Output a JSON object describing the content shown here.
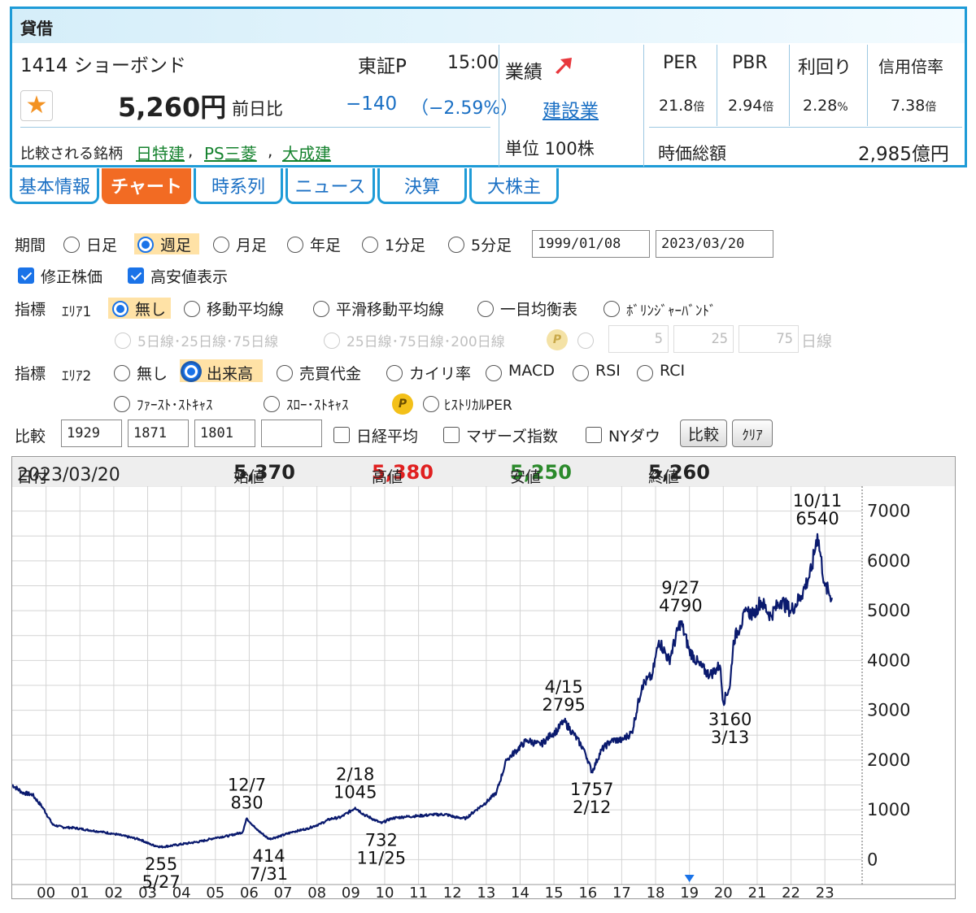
{
  "header": {
    "badge": "貸借",
    "code_name": "1414 ショーボンド",
    "market": "東証P",
    "time": "15:00",
    "price": "5,260円",
    "change_label": "前日比",
    "change": "−140",
    "change_pct": "（−2.59%）",
    "compare_label": "比較される銘柄",
    "compare_links": [
      "日特建",
      "PS三菱",
      "大成建"
    ],
    "sep": ",",
    "performance_label": "業績",
    "industry": "建設業",
    "unit": "単位 100株",
    "metrics": [
      {
        "name": "PER",
        "value": "21.8",
        "unit": "倍"
      },
      {
        "name": "PBR",
        "value": "2.94",
        "unit": "倍"
      },
      {
        "name": "利回り",
        "value": "2.28",
        "unit": "%"
      },
      {
        "name": "信用倍率",
        "value": "7.38",
        "unit": "倍"
      }
    ],
    "market_cap_label": "時価総額",
    "market_cap": "2,985億円",
    "colors": {
      "accent": "#1e9bd7",
      "down": "#1b70c4",
      "link": "#15822e",
      "tab_active": "#f26b23"
    }
  },
  "tabs": [
    "基本情報",
    "チャート",
    "時系列",
    "ニュース",
    "決算",
    "大株主"
  ],
  "controls": {
    "period_label": "期間",
    "period_options": [
      "日足",
      "週足",
      "月足",
      "年足",
      "1分足",
      "5分足"
    ],
    "date_from": "1999/01/08",
    "date_to": "2023/03/20",
    "adjusted": "修正株価",
    "show_high_low": "高安値表示",
    "indicator_label": "指標",
    "area1": "ｴﾘｱ1",
    "area1_options": [
      "無し",
      "移動平均線",
      "平滑移動平均線",
      "一目均衡表",
      "ﾎﾞﾘﾝｼﾞｬｰﾊﾞﾝﾄﾞ"
    ],
    "ma_options": [
      "5日線･25日線･75日線",
      "25日線･75日線･200日線"
    ],
    "ma_values": [
      "5",
      "25",
      "75"
    ],
    "ma_unit": "日線",
    "area2": "ｴﾘｱ2",
    "area2_options": [
      "無し",
      "出来高",
      "売買代金",
      "カイリ率",
      "MACD",
      "RSI",
      "RCI"
    ],
    "area2_options_row2": [
      "ﾌｧｰｽﾄ･ｽﾄｷｬｽ",
      "ｽﾛｰ･ｽﾄｷｬｽ",
      "ﾋｽﾄﾘｶﾙPER"
    ],
    "premium_badge": "P",
    "compare_label": "比較",
    "compare_codes": [
      "1929",
      "1871",
      "1801",
      ""
    ],
    "index_options": [
      "日経平均",
      "マザーズ指数",
      "NYダウ"
    ],
    "compare_button": "比較",
    "clear_button": "ｸﾘｱ"
  },
  "ohlc": {
    "date_label": "日付",
    "date": "2023/03/20",
    "open_label": "始値",
    "open": "5,370",
    "high_label": "高値",
    "high": "5,380",
    "low_label": "安値",
    "low": "5,250",
    "close_label": "終値",
    "close": "5,260",
    "high_color": "#e02020",
    "low_color": "#2b8a2b"
  },
  "chart_data": {
    "type": "line",
    "x_tick_labels": [
      "00",
      "01",
      "02",
      "03",
      "04",
      "05",
      "06",
      "07",
      "08",
      "09",
      "10",
      "11",
      "12",
      "13",
      "14",
      "15",
      "16",
      "17",
      "18",
      "19",
      "20",
      "21",
      "22",
      "23"
    ],
    "y_tick_labels": [
      "0",
      "1000",
      "2000",
      "3000",
      "4000",
      "5000",
      "6000",
      "7000"
    ],
    "ylim": [
      -500,
      7500
    ],
    "xlim": [
      1999.0,
      2024.1
    ],
    "series": [
      {
        "color": "#0a1a6e",
        "x": [
          1999.0,
          1999.3,
          1999.6,
          1999.9,
          2000.2,
          2000.5,
          2000.8,
          2001.2,
          2001.6,
          2002.0,
          2002.4,
          2002.8,
          2003.1,
          2003.4,
          2003.8,
          2004.2,
          2004.6,
          2005.0,
          2005.4,
          2005.8,
          2005.93,
          2006.2,
          2006.58,
          2006.9,
          2007.3,
          2007.7,
          2008.1,
          2008.4,
          2008.7,
          2009.0,
          2009.13,
          2009.4,
          2009.7,
          2009.9,
          2010.2,
          2010.6,
          2011.0,
          2011.4,
          2011.8,
          2012.1,
          2012.4,
          2012.7,
          2013.0,
          2013.3,
          2013.6,
          2013.9,
          2014.2,
          2014.6,
          2014.9,
          2015.1,
          2015.29,
          2015.6,
          2015.9,
          2016.12,
          2016.4,
          2016.7,
          2017.0,
          2017.3,
          2017.6,
          2017.9,
          2018.1,
          2018.4,
          2018.74,
          2019.0,
          2019.3,
          2019.6,
          2019.9,
          2020.0,
          2020.2,
          2020.3,
          2020.5,
          2020.7,
          2020.9,
          2021.1,
          2021.4,
          2021.7,
          2022.0,
          2022.3,
          2022.6,
          2022.78,
          2023.0,
          2023.21
        ],
        "y": [
          1500,
          1350,
          1300,
          1050,
          700,
          650,
          640,
          600,
          560,
          520,
          460,
          400,
          300,
          255,
          290,
          330,
          370,
          440,
          480,
          550,
          830,
          620,
          414,
          470,
          560,
          620,
          720,
          820,
          850,
          980,
          1045,
          900,
          800,
          732,
          830,
          860,
          880,
          900,
          910,
          850,
          830,
          1000,
          1150,
          1350,
          2000,
          2200,
          2400,
          2300,
          2500,
          2600,
          2795,
          2500,
          2200,
          1757,
          2200,
          2400,
          2400,
          2550,
          3500,
          3700,
          4400,
          4000,
          4790,
          4200,
          3900,
          3700,
          3900,
          3160,
          3500,
          4400,
          4700,
          5000,
          4900,
          5200,
          4900,
          5200,
          5000,
          5300,
          5800,
          6540,
          5500,
          5260
        ]
      }
    ],
    "annotations": [
      {
        "x": 2003.4,
        "y": 255,
        "date": "5/27",
        "value": "255",
        "pos": "below"
      },
      {
        "x": 2005.93,
        "y": 830,
        "date": "12/7",
        "value": "830",
        "pos": "above"
      },
      {
        "x": 2006.58,
        "y": 414,
        "date": "7/31",
        "value": "414",
        "pos": "below"
      },
      {
        "x": 2009.13,
        "y": 1045,
        "date": "2/18",
        "value": "1045",
        "pos": "above"
      },
      {
        "x": 2009.9,
        "y": 732,
        "date": "11/25",
        "value": "732",
        "pos": "below"
      },
      {
        "x": 2015.29,
        "y": 2795,
        "date": "4/15",
        "value": "2795",
        "pos": "above"
      },
      {
        "x": 2016.12,
        "y": 1757,
        "date": "2/12",
        "value": "1757",
        "pos": "below"
      },
      {
        "x": 2018.74,
        "y": 4790,
        "date": "9/27",
        "value": "4790",
        "pos": "above"
      },
      {
        "x": 2020.2,
        "y": 3160,
        "date": "3/13",
        "value": "3160",
        "pos": "below"
      },
      {
        "x": 2022.78,
        "y": 6540,
        "date": "10/11",
        "value": "6540",
        "pos": "above"
      }
    ],
    "grid": true,
    "marker_year": "19"
  }
}
